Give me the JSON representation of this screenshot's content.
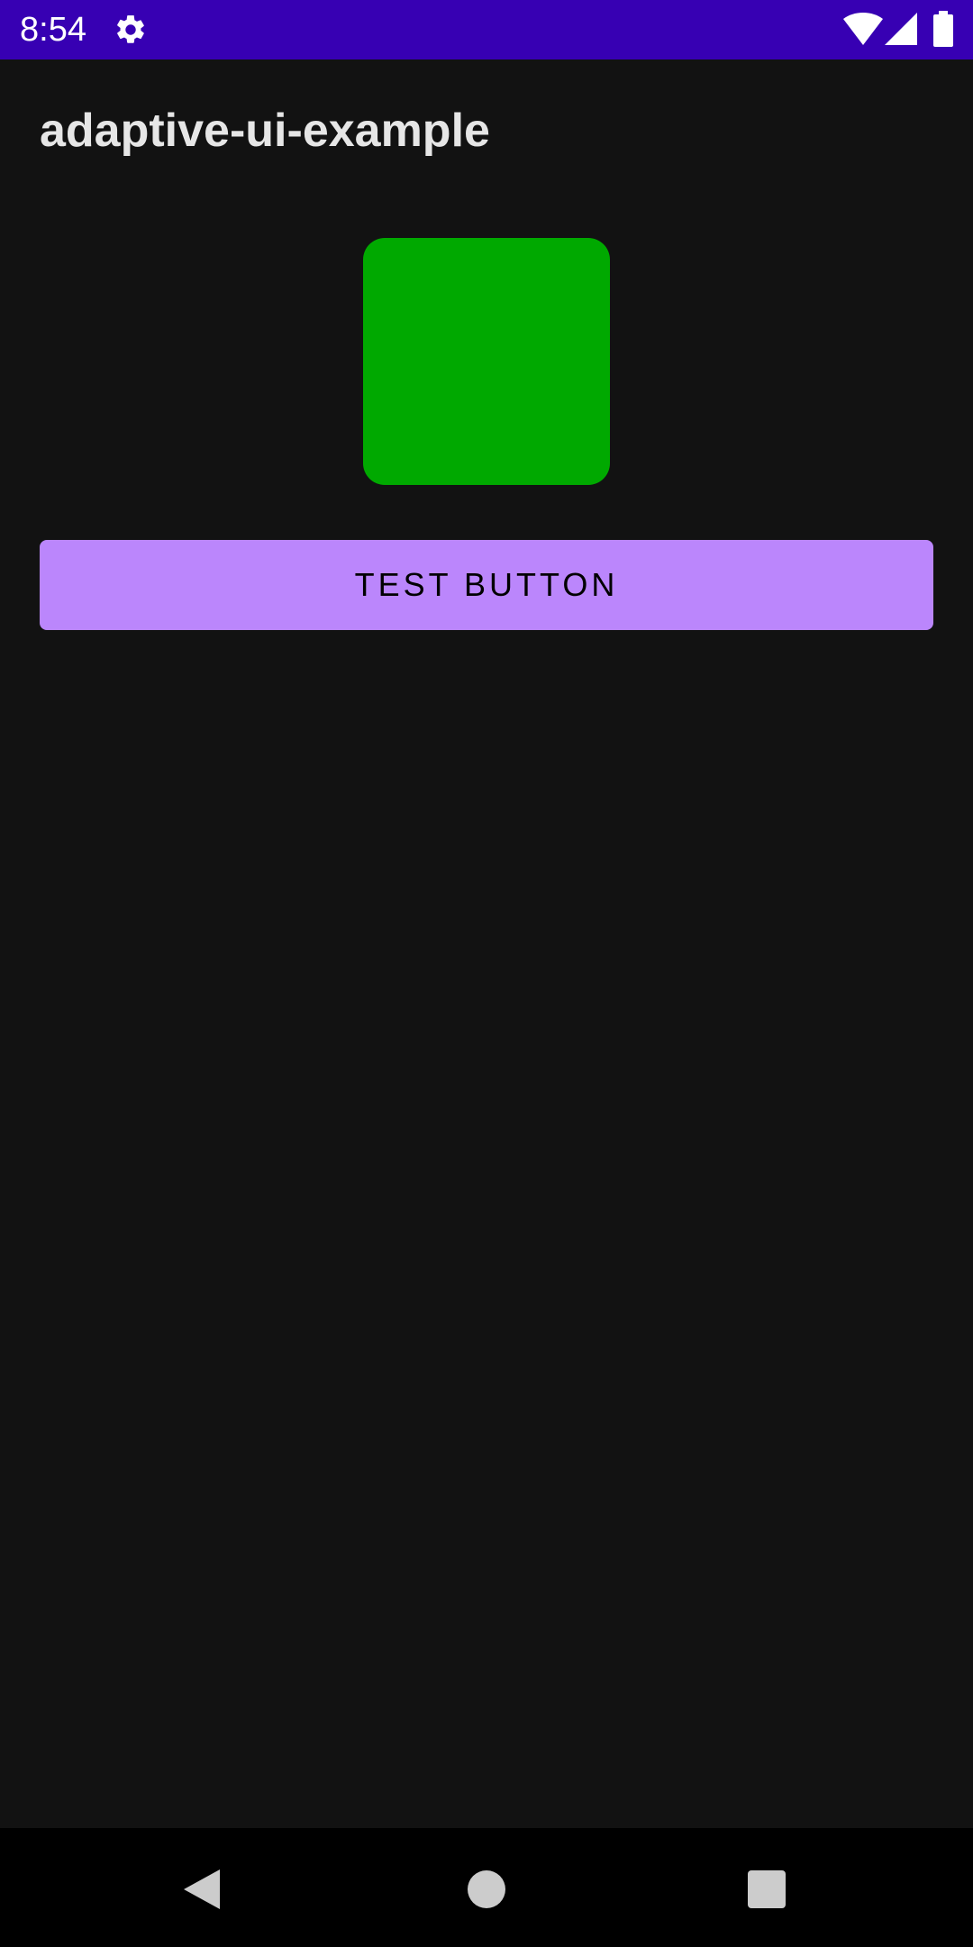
{
  "status_bar": {
    "time": "8:54",
    "background": "#3700b3",
    "icons": [
      "gear-icon",
      "wifi-icon",
      "signal-icon",
      "battery-icon"
    ]
  },
  "app": {
    "title": "adaptive-ui-example"
  },
  "content": {
    "square_color": "#00a900",
    "button_label": "TEST BUTTON",
    "button_color": "#bb86fc"
  },
  "nav_bar": {
    "icons": [
      "back-icon",
      "home-icon",
      "recents-icon"
    ]
  }
}
